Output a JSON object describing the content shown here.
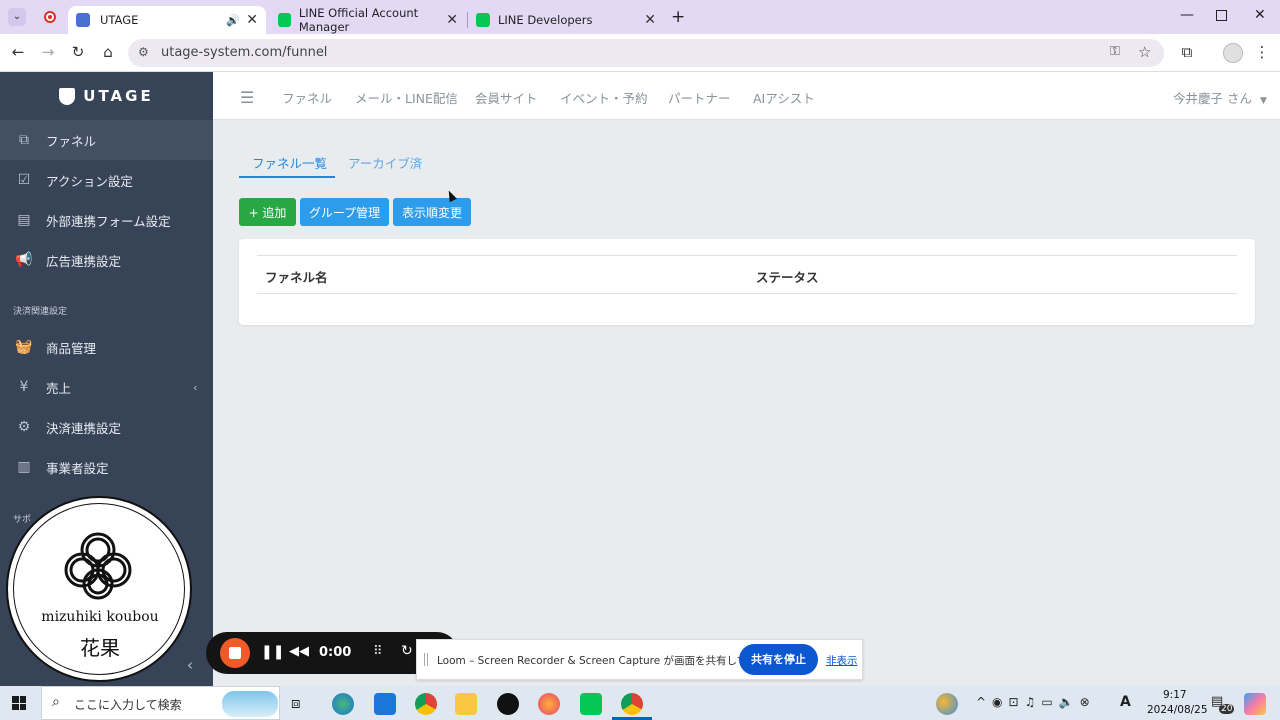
{
  "browser": {
    "tabs": [
      {
        "title": "UTAGE",
        "favicon": "utage-favicon",
        "color": "#3b5998"
      },
      {
        "title": "LINE Official Account Manager",
        "favicon": "line-favicon",
        "color": "#06c755"
      },
      {
        "title": "LINE Developers",
        "favicon": "line-dev-favicon",
        "color": "#06c755"
      }
    ],
    "url": "utage-system.com/funnel"
  },
  "sidebar": {
    "logo": "UTAGE",
    "items": [
      {
        "label": "ファネル",
        "icon": "funnel-icon"
      },
      {
        "label": "アクション設定",
        "icon": "checkbox-icon"
      },
      {
        "label": "外部連携フォーム設定",
        "icon": "form-icon"
      },
      {
        "label": "広告連携設定",
        "icon": "megaphone-icon"
      }
    ],
    "section_payment": "決済関連設定",
    "payment_items": [
      {
        "label": "商品管理",
        "icon": "basket-icon"
      },
      {
        "label": "売上",
        "icon": "yen-icon"
      },
      {
        "label": "決済連携設定",
        "icon": "gear-icon"
      },
      {
        "label": "事業者設定",
        "icon": "building-icon"
      }
    ],
    "section_support": "サポ"
  },
  "topnav": {
    "links": [
      "ファネル",
      "メール・LINE配信",
      "会員サイト",
      "イベント・予約",
      "パートナー",
      "AIアシスト"
    ],
    "user": "今井慶子 さん"
  },
  "content": {
    "tabs": [
      "ファネル一覧",
      "アーカイブ済"
    ],
    "buttons": {
      "add": "+ 追加",
      "group": "グループ管理",
      "order": "表示順変更"
    },
    "table_headers": [
      "ファネル名",
      "ステータス"
    ]
  },
  "overlay": {
    "badge_name": "mizuhiki koubou",
    "badge_kanji": "花果",
    "loom_time": "0:00",
    "share_text": "Loom – Screen Recorder & Screen Capture が画面を共有しています。",
    "share_stop": "共有を停止",
    "share_hide": "非表示"
  },
  "taskbar": {
    "search_placeholder": "ここに入力して検索",
    "time": "9:17",
    "date": "2024/08/25",
    "notifications": "20"
  },
  "colors": {
    "sidebar": "#374357",
    "accent": "#1e88e5",
    "add_button": "#28a745",
    "blue_button": "#2d9cea"
  }
}
